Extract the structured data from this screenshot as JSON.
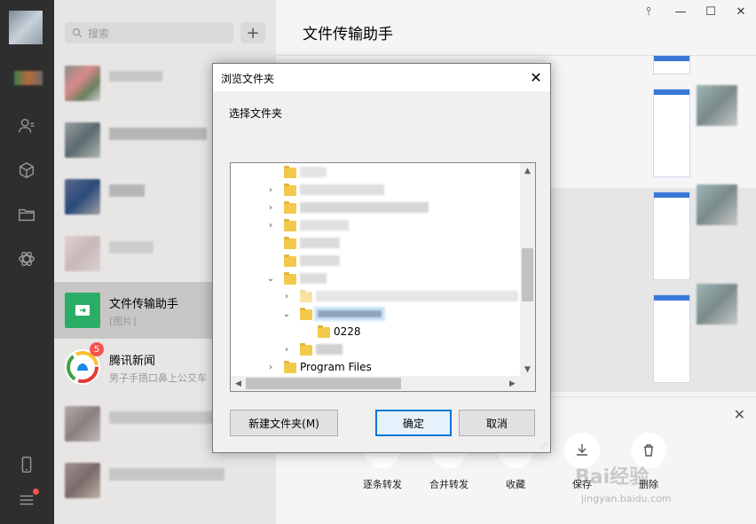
{
  "sidebar": {
    "icons": [
      "contacts-icon",
      "cube-icon",
      "folder-icon",
      "mini-program-icon",
      "phone-icon",
      "menu-icon"
    ]
  },
  "chatlist": {
    "search_placeholder": "搜索",
    "plus_label": "+",
    "items": [
      {
        "name": "文件传输助手",
        "subtitle": "[图片]",
        "active": true
      },
      {
        "name": "腾讯新闻",
        "subtitle": "男子手捂口鼻上公交车",
        "badge": "5"
      }
    ]
  },
  "main": {
    "title": "文件传输助手",
    "window_controls": [
      "pin-icon",
      "minimize-icon",
      "maximize-icon",
      "close-icon"
    ],
    "actions": [
      {
        "label": "逐条转发"
      },
      {
        "label": "合并转发"
      },
      {
        "label": "收藏"
      },
      {
        "label": "保存"
      },
      {
        "label": "删除"
      }
    ],
    "close_label": "✕"
  },
  "dialog": {
    "title": "浏览文件夹",
    "close_label": "✕",
    "description": "选择文件夹",
    "tree": {
      "selected_child": "0228",
      "program_files": "Program Files"
    },
    "buttons": {
      "new_folder": "新建文件夹(M)",
      "ok": "确定",
      "cancel": "取消"
    }
  },
  "watermark": {
    "text": "Bai经验",
    "url": "jingyan.baidu.com"
  }
}
